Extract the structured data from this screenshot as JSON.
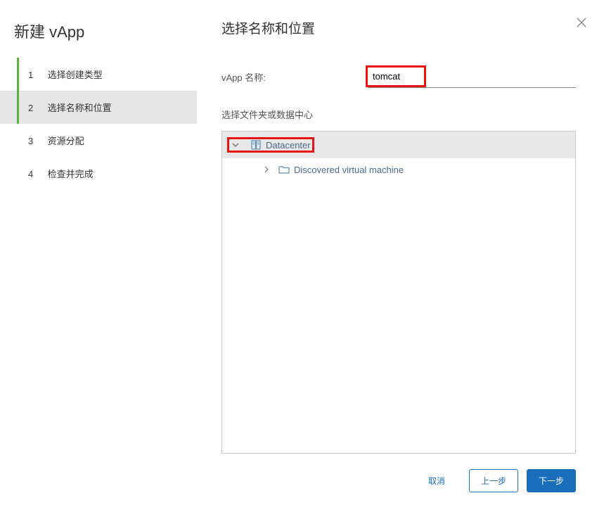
{
  "wizard": {
    "title": "新建 vApp",
    "steps": [
      {
        "num": "1",
        "label": "选择创建类型"
      },
      {
        "num": "2",
        "label": "选择名称和位置"
      },
      {
        "num": "3",
        "label": "资源分配"
      },
      {
        "num": "4",
        "label": "检查并完成"
      }
    ]
  },
  "panel": {
    "title": "选择名称和位置",
    "nameLabel": "vApp 名称:",
    "nameValue": "tomcat",
    "folderLabel": "选择文件夹或数据中心"
  },
  "tree": {
    "root": {
      "label": "Datacenter"
    },
    "child": {
      "label": "Discovered virtual machine"
    }
  },
  "footer": {
    "cancel": "取消",
    "back": "上一步",
    "next": "下一步"
  }
}
